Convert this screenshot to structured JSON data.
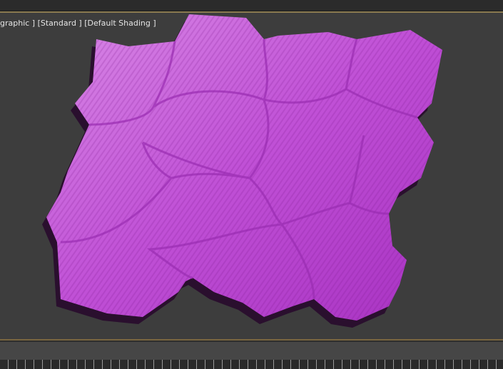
{
  "viewport": {
    "label": "graphic ] [Standard ] [Default Shading ]",
    "object_color": "#c45ad6",
    "border_color": "#8a7a50"
  }
}
